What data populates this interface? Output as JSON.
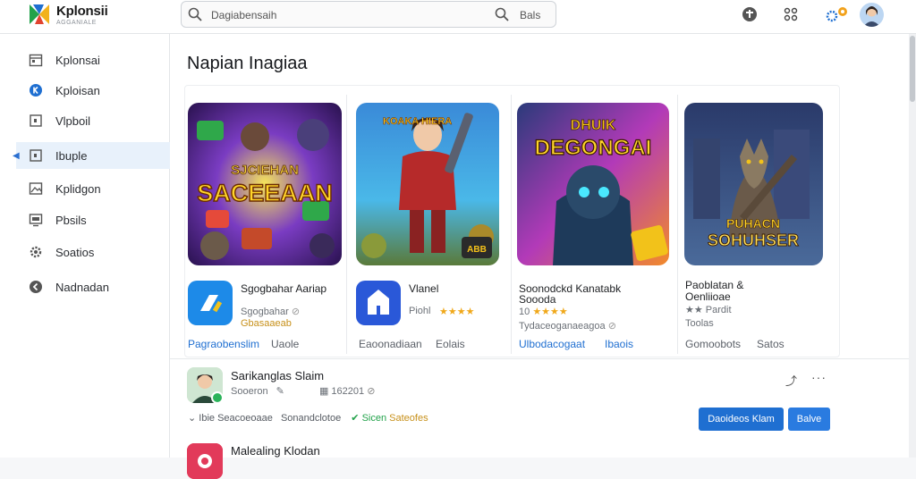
{
  "header": {
    "brand": "Kplonsii",
    "brand_sub": "AGGANIALE",
    "search_placeholder": "Dagiabensaih",
    "search_button_label": "Bals"
  },
  "sidebar": {
    "items": [
      {
        "label": "Kplonsai",
        "icon": "calendar-icon"
      },
      {
        "label": "Kploisan",
        "icon": "k-circle-icon"
      },
      {
        "label": "Vlpboil",
        "icon": "square-icon"
      },
      {
        "label": "Ibuple",
        "icon": "square-icon",
        "active": true
      },
      {
        "label": "Kplidgon",
        "icon": "image-icon"
      },
      {
        "label": "Pbsils",
        "icon": "monitor-icon"
      },
      {
        "label": "Soatios",
        "icon": "gear-icon"
      },
      {
        "label": "Nadnadan",
        "icon": "back-circle-icon"
      }
    ]
  },
  "main": {
    "section_title": "Napian Inagiaa",
    "cards": [
      {
        "art_title": "SACEEAAN",
        "art_title_top": "SJCIEHAN",
        "name": "Sgogbahar Aariap",
        "meta": "Sgogbahar",
        "rating_text": "Gbasaaeab",
        "link_primary": "Pagraobenslim",
        "link_secondary": "Uaole"
      },
      {
        "art_title": "KOAKA HIERA",
        "name": "Vlanel",
        "meta": "Piohl",
        "rating_text": "★★★★",
        "link_primary": "Eaoonadiaan",
        "link_secondary": "Eolais"
      },
      {
        "art_title": "DEGONGAI",
        "art_title_top": "DHUIK",
        "name": "Soonodckd Kanatabk",
        "name2": "Soooda",
        "meta": "10",
        "rating_text": "★★★★",
        "meta2": "Tydaceoganaeagoa",
        "link_primary": "Ulbodacogaat",
        "link_secondary": "Ibaois"
      },
      {
        "art_title": "SOHUHSER",
        "art_title_top": "PUHACN",
        "name": "Paoblatan &",
        "name2": "Oenliioae",
        "meta": "★★ Pardit",
        "meta2": "Toolas",
        "link_primary": "Gomoobots",
        "link_secondary": "Satos"
      }
    ],
    "item": {
      "title": "Sarikanglas Slaim",
      "sub_author": "Sooeron",
      "sub_date": "162201",
      "tag_1": "Ibie",
      "tag_2": "Seacoeoaae",
      "tag_3": "Sonandclotoe",
      "tag_green": "Sicen",
      "tag_orange": "Sateofes",
      "btn_primary": "Daoideos Klam",
      "btn_secondary": "Balve"
    },
    "item2": {
      "title": "Malealing Klodan"
    }
  },
  "colors": {
    "accent": "#1f6fd1",
    "active_bg": "#e8f1fb",
    "star": "#f0a81a",
    "online": "#2bb35a"
  }
}
